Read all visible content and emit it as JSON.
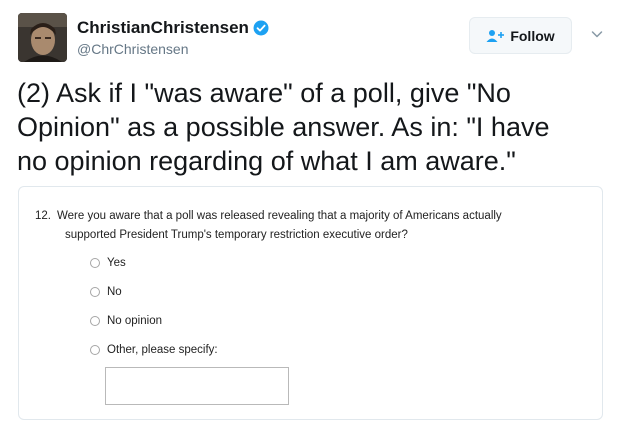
{
  "author": {
    "display_name": "ChristianChristensen",
    "handle": "@ChrChristensen",
    "verified": true,
    "avatar_icon": "profile-photo"
  },
  "actions": {
    "follow_label": "Follow",
    "follow_icon": "add-user-icon",
    "more_icon": "chevron-down-icon"
  },
  "tweet": {
    "line1": "(2) Ask if I \"was aware\" of a poll, give \"No",
    "line2": "Opinion\" as a possible answer. As in: \"I have",
    "line3": "no opinion regarding of what I am aware.\""
  },
  "survey": {
    "number": "12.",
    "question_line1": "Were you aware that a poll was released revealing that a majority of Americans actually",
    "question_line2": "supported President Trump's temporary restriction executive order?",
    "options": [
      "Yes",
      "No",
      "No opinion",
      "Other, please specify:"
    ]
  },
  "colors": {
    "verified": "#1da1f2",
    "follow_icon": "#1da1f2",
    "text_primary": "#14171a",
    "text_secondary": "#657786"
  }
}
